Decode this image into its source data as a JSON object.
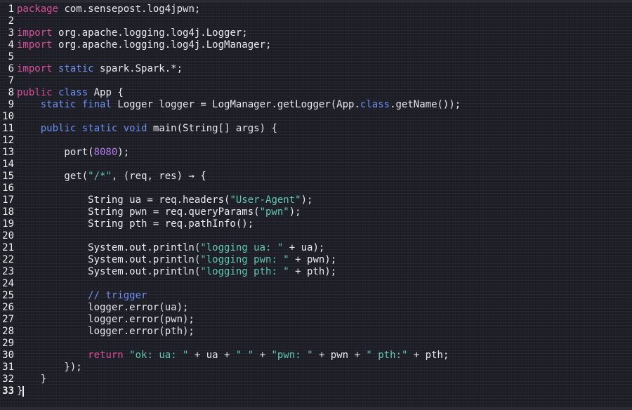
{
  "editor": {
    "lines": [
      {
        "n": "1",
        "tokens": [
          {
            "t": "package",
            "c": "kw"
          },
          {
            "t": " com.sensepost.log4jpwn;",
            "c": "plain"
          }
        ]
      },
      {
        "n": "2",
        "tokens": []
      },
      {
        "n": "3",
        "tokens": [
          {
            "t": "import",
            "c": "kw"
          },
          {
            "t": " org.apache.logging.log4j.Logger;",
            "c": "plain"
          }
        ]
      },
      {
        "n": "4",
        "tokens": [
          {
            "t": "import",
            "c": "kw"
          },
          {
            "t": " org.apache.logging.log4j.LogManager;",
            "c": "plain"
          }
        ]
      },
      {
        "n": "5",
        "tokens": []
      },
      {
        "n": "6",
        "tokens": [
          {
            "t": "import",
            "c": "kw"
          },
          {
            "t": " ",
            "c": "plain"
          },
          {
            "t": "static",
            "c": "kw2"
          },
          {
            "t": " spark.Spark.*;",
            "c": "plain"
          }
        ]
      },
      {
        "n": "7",
        "tokens": []
      },
      {
        "n": "8",
        "tokens": [
          {
            "t": "public",
            "c": "kw"
          },
          {
            "t": " ",
            "c": "plain"
          },
          {
            "t": "class",
            "c": "kw2"
          },
          {
            "t": " App {",
            "c": "plain"
          }
        ]
      },
      {
        "n": "9",
        "tokens": [
          {
            "t": "    ",
            "c": "plain"
          },
          {
            "t": "static",
            "c": "kw2"
          },
          {
            "t": " ",
            "c": "plain"
          },
          {
            "t": "final",
            "c": "kw2"
          },
          {
            "t": " Logger logger = LogManager.getLogger(App.",
            "c": "plain"
          },
          {
            "t": "class",
            "c": "kw2"
          },
          {
            "t": ".getName());",
            "c": "plain"
          }
        ]
      },
      {
        "n": "10",
        "tokens": []
      },
      {
        "n": "11",
        "tokens": [
          {
            "t": "    ",
            "c": "plain"
          },
          {
            "t": "public",
            "c": "kw2"
          },
          {
            "t": " ",
            "c": "plain"
          },
          {
            "t": "static",
            "c": "kw2"
          },
          {
            "t": " ",
            "c": "plain"
          },
          {
            "t": "void",
            "c": "kw2"
          },
          {
            "t": " main(String[] args) {",
            "c": "plain"
          }
        ]
      },
      {
        "n": "12",
        "tokens": []
      },
      {
        "n": "13",
        "tokens": [
          {
            "t": "        port(",
            "c": "plain"
          },
          {
            "t": "8080",
            "c": "num"
          },
          {
            "t": ");",
            "c": "plain"
          }
        ]
      },
      {
        "n": "14",
        "tokens": []
      },
      {
        "n": "15",
        "tokens": [
          {
            "t": "        get(",
            "c": "plain"
          },
          {
            "t": "\"/*\"",
            "c": "str"
          },
          {
            "t": ", (req, res) → {",
            "c": "plain"
          }
        ]
      },
      {
        "n": "16",
        "tokens": []
      },
      {
        "n": "17",
        "tokens": [
          {
            "t": "            String ua = req.headers(",
            "c": "plain"
          },
          {
            "t": "\"User-Agent\"",
            "c": "str"
          },
          {
            "t": ");",
            "c": "plain"
          }
        ]
      },
      {
        "n": "18",
        "tokens": [
          {
            "t": "            String pwn = req.queryParams(",
            "c": "plain"
          },
          {
            "t": "\"pwn\"",
            "c": "str"
          },
          {
            "t": ");",
            "c": "plain"
          }
        ]
      },
      {
        "n": "19",
        "tokens": [
          {
            "t": "            String pth = req.pathInfo();",
            "c": "plain"
          }
        ]
      },
      {
        "n": "20",
        "tokens": []
      },
      {
        "n": "21",
        "tokens": [
          {
            "t": "            System.out.println(",
            "c": "plain"
          },
          {
            "t": "\"logging ua: \"",
            "c": "str"
          },
          {
            "t": " + ua);",
            "c": "plain"
          }
        ]
      },
      {
        "n": "22",
        "tokens": [
          {
            "t": "            System.out.println(",
            "c": "plain"
          },
          {
            "t": "\"logging pwn: \"",
            "c": "str"
          },
          {
            "t": " + pwn);",
            "c": "plain"
          }
        ]
      },
      {
        "n": "23",
        "tokens": [
          {
            "t": "            System.out.println(",
            "c": "plain"
          },
          {
            "t": "\"logging pth: \"",
            "c": "str"
          },
          {
            "t": " + pth);",
            "c": "plain"
          }
        ]
      },
      {
        "n": "24",
        "tokens": []
      },
      {
        "n": "25",
        "tokens": [
          {
            "t": "            ",
            "c": "plain"
          },
          {
            "t": "// trigger",
            "c": "cmt"
          }
        ]
      },
      {
        "n": "26",
        "tokens": [
          {
            "t": "            logger.error(ua);",
            "c": "plain"
          }
        ]
      },
      {
        "n": "27",
        "tokens": [
          {
            "t": "            logger.error(pwn);",
            "c": "plain"
          }
        ]
      },
      {
        "n": "28",
        "tokens": [
          {
            "t": "            logger.error(pth);",
            "c": "plain"
          }
        ]
      },
      {
        "n": "29",
        "tokens": []
      },
      {
        "n": "30",
        "tokens": [
          {
            "t": "            ",
            "c": "plain"
          },
          {
            "t": "return",
            "c": "kw"
          },
          {
            "t": " ",
            "c": "plain"
          },
          {
            "t": "\"ok: ua: \"",
            "c": "str"
          },
          {
            "t": " + ua + ",
            "c": "plain"
          },
          {
            "t": "\" \"",
            "c": "str"
          },
          {
            "t": " + ",
            "c": "plain"
          },
          {
            "t": "\"pwn: \"",
            "c": "str"
          },
          {
            "t": " + pwn + ",
            "c": "plain"
          },
          {
            "t": "\" pth:\"",
            "c": "str"
          },
          {
            "t": " + pth;",
            "c": "plain"
          }
        ]
      },
      {
        "n": "31",
        "tokens": [
          {
            "t": "        });",
            "c": "plain"
          }
        ]
      },
      {
        "n": "32",
        "tokens": [
          {
            "t": "    }",
            "c": "plain"
          }
        ]
      },
      {
        "n": "33",
        "tokens": [
          {
            "t": "}",
            "c": "plain"
          }
        ],
        "current": true
      }
    ],
    "colors": {
      "background": "#1d1d26",
      "keyword": "#d94f9e",
      "keyword_secondary": "#6d8ff0",
      "string": "#5fc8b4",
      "number": "#b07ce8",
      "comment": "#6d8ff0",
      "text": "#e8e8f0"
    }
  }
}
